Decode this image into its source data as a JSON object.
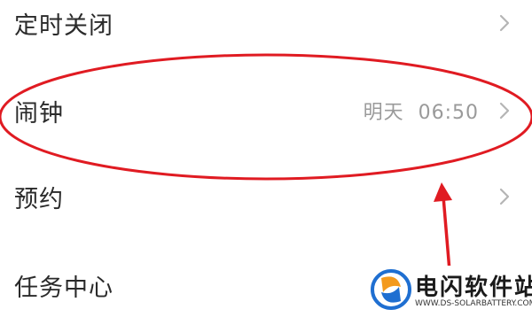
{
  "menu": {
    "items": [
      {
        "label": "定时关闭",
        "value": "",
        "has_chevron": true
      },
      {
        "label": "闹钟",
        "value": "明天  06:50",
        "has_chevron": true
      },
      {
        "label": "预约",
        "value": "",
        "has_chevron": true
      },
      {
        "label": "任务中心",
        "value": "",
        "has_chevron": false
      }
    ]
  },
  "annotation": {
    "highlight_color": "#e01b22",
    "arrow_color": "#e01b22"
  },
  "watermark": {
    "title": "电闪软件站",
    "url": "WWW.DS-SOLARBATTERY.COM",
    "accent_orange": "#f39a1e",
    "accent_blue": "#1f6fd1"
  }
}
